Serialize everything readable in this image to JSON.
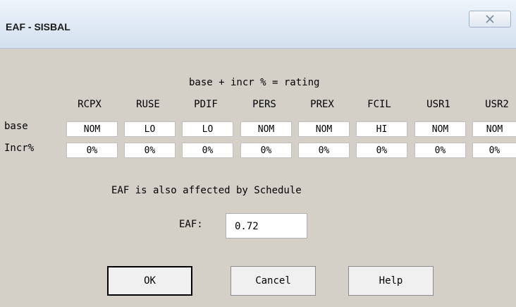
{
  "window": {
    "title": "EAF - SISBAL",
    "close_icon": "close-icon"
  },
  "formula": "base + incr % = rating",
  "columns": [
    "RCPX",
    "RUSE",
    "PDIF",
    "PERS",
    "PREX",
    "FCIL",
    "USR1",
    "USR2"
  ],
  "rows": {
    "base": {
      "label": "base",
      "values": [
        "NOM",
        "LO",
        "LO",
        "NOM",
        "NOM",
        "HI",
        "NOM",
        "NOM"
      ]
    },
    "incr": {
      "label": "Incr%",
      "values": [
        "0%",
        "0%",
        "0%",
        "0%",
        "0%",
        "0%",
        "0%",
        "0%"
      ]
    }
  },
  "note": "EAF is also affected by Schedule",
  "eaf": {
    "label": "EAF:",
    "value": "0.72"
  },
  "buttons": {
    "ok": "OK",
    "cancel": "Cancel",
    "help": "Help"
  }
}
